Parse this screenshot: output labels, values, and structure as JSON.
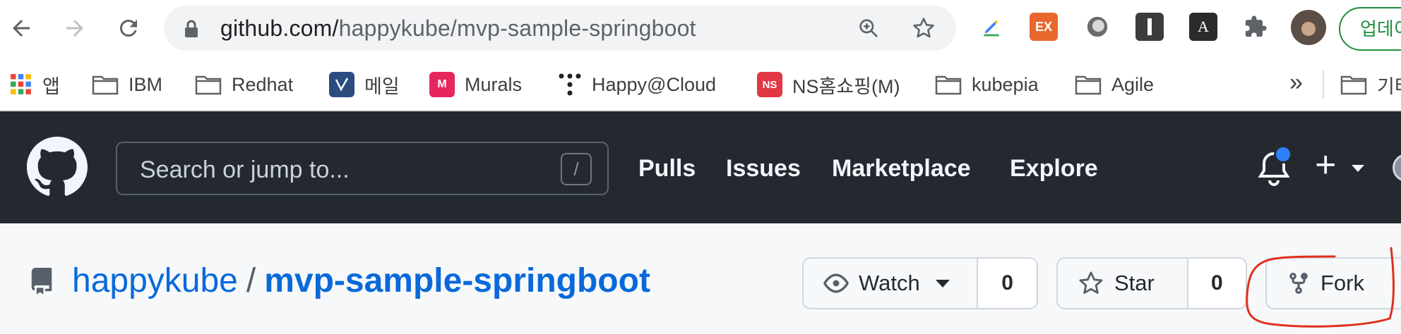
{
  "browser": {
    "url_host": "github.com/",
    "url_path": "happykube/mvp-sample-springboot",
    "update_label": "업데이트",
    "icons": [
      "back-icon",
      "forward-icon",
      "reload-icon",
      "lock-icon",
      "zoom-icon",
      "star-icon",
      "puzzle-icon"
    ]
  },
  "bookmarks": {
    "items": [
      {
        "label": "앱",
        "icon": "apps-grid-icon"
      },
      {
        "label": "IBM",
        "icon": "folder-icon"
      },
      {
        "label": "Redhat",
        "icon": "folder-icon"
      },
      {
        "label": "메일",
        "icon": "mail-icon"
      },
      {
        "label": "Murals",
        "icon": "murals-icon"
      },
      {
        "label": "Happy@Cloud",
        "icon": "dots-icon"
      },
      {
        "label": "NS홈쇼핑(M)",
        "icon": "ns-icon"
      },
      {
        "label": "kubepia",
        "icon": "folder-icon"
      },
      {
        "label": "Agile",
        "icon": "folder-icon"
      }
    ],
    "more_label": "»",
    "overflow_label": "기타",
    "ns_badge": "NS",
    "murals_badge": "M",
    "ex_badge": "EX"
  },
  "github": {
    "search_placeholder": "Search or jump to...",
    "search_shortcut": "/",
    "nav": [
      "Pulls",
      "Issues",
      "Marketplace",
      "Explore"
    ],
    "plus": "+"
  },
  "repo": {
    "owner": "happykube",
    "separator": "/",
    "name": "mvp-sample-springboot",
    "watch_label": "Watch",
    "watch_count": "0",
    "star_label": "Star",
    "star_count": "0",
    "fork_label": "Fork"
  },
  "colors": {
    "header_bg": "#24292f",
    "link_blue": "#0969da",
    "notification_dot": "#2f81f7",
    "update_green": "#1e8e3e",
    "annotation_red": "#e0301e"
  }
}
